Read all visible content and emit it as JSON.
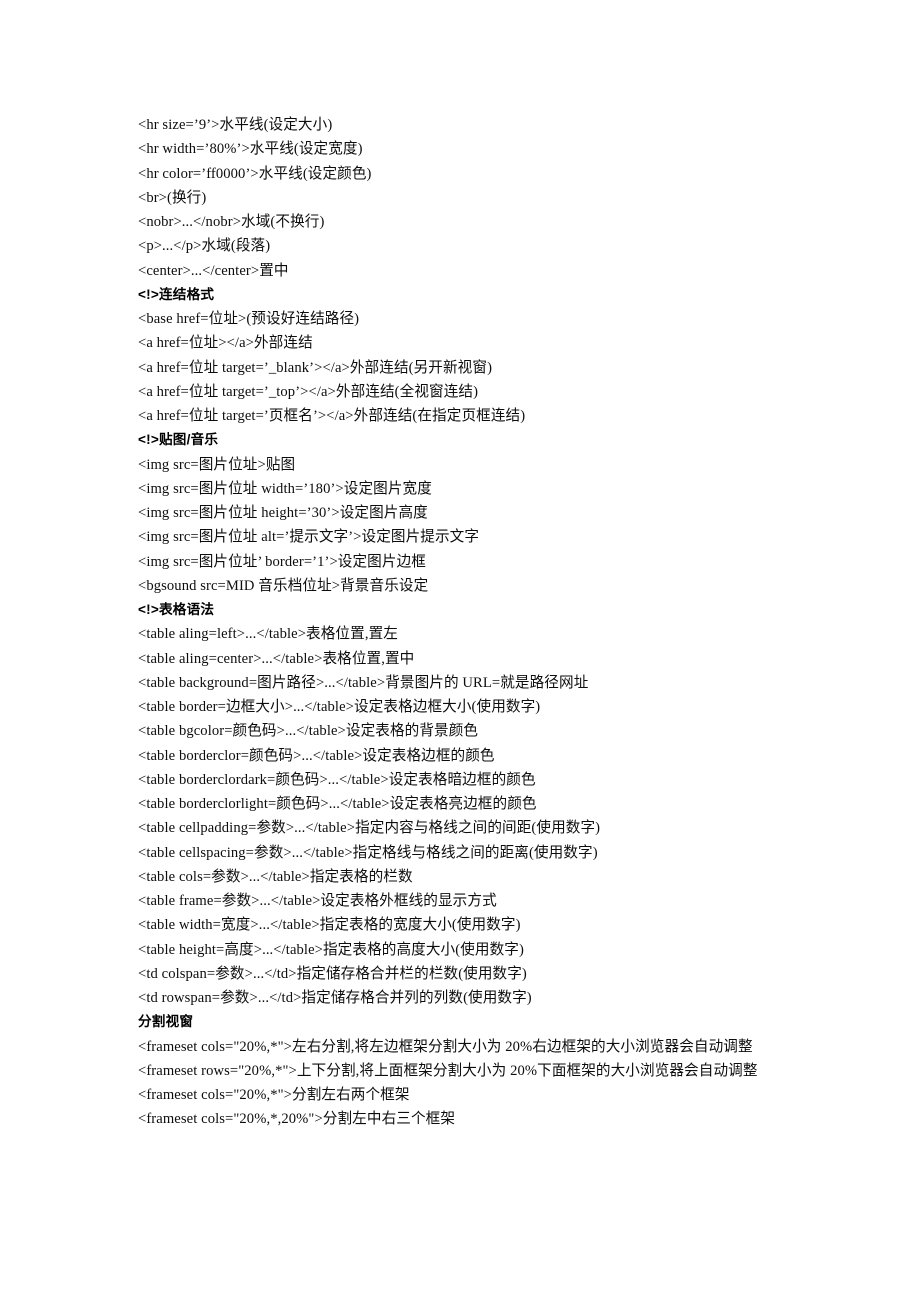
{
  "document": {
    "sections": [
      {
        "id": "horizontal-rule-and-text-block",
        "heading": null,
        "lines": [
          "<hr size=’9’>水平线(设定大小)",
          "<hr width=’80%’>水平线(设定宽度)",
          "<hr color=’ff0000’>水平线(设定颜色)",
          "<br>(换行)",
          "<nobr>...</nobr>水域(不换行)",
          "<p>...</p>水域(段落)",
          "<center>...</center>置中"
        ]
      },
      {
        "id": "link-format",
        "heading": "<!>连结格式",
        "lines": [
          "<base href=位址>(预设好连结路径)",
          "<a href=位址></a>外部连结",
          "<a href=位址 target=’_blank’></a>外部连结(另开新视窗)",
          "<a href=位址 target=’_top’></a>外部连结(全视窗连结)",
          "<a href=位址 target=’页框名’></a>外部连结(在指定页框连结)"
        ]
      },
      {
        "id": "image-and-music",
        "heading": "<!>贴图/音乐",
        "lines": [
          "<img src=图片位址>贴图",
          "<img src=图片位址 width=’180’>设定图片宽度",
          "<img src=图片位址 height=’30’>设定图片高度",
          "<img src=图片位址 alt=’提示文字’>设定图片提示文字",
          "<img src=图片位址’ border=’1’>设定图片边框",
          "<bgsound src=MID 音乐档位址>背景音乐设定"
        ]
      },
      {
        "id": "table-syntax",
        "heading": "<!>表格语法",
        "lines": [
          "<table aling=left>...</table>表格位置,置左",
          "<table aling=center>...</table>表格位置,置中",
          "<table background=图片路径>...</table>背景图片的 URL=就是路径网址",
          "<table border=边框大小>...</table>设定表格边框大小(使用数字)",
          "<table bgcolor=颜色码>...</table>设定表格的背景颜色",
          "<table borderclor=颜色码>...</table>设定表格边框的颜色",
          "<table borderclordark=颜色码>...</table>设定表格暗边框的颜色",
          "<table borderclorlight=颜色码>...</table>设定表格亮边框的颜色",
          "<table cellpadding=参数>...</table>指定内容与格线之间的间距(使用数字)",
          "<table cellspacing=参数>...</table>指定格线与格线之间的距离(使用数字)",
          "<table cols=参数>...</table>指定表格的栏数",
          "<table frame=参数>...</table>设定表格外框线的显示方式",
          "<table width=宽度>...</table>指定表格的宽度大小(使用数字)",
          "<table height=高度>...</table>指定表格的高度大小(使用数字)",
          "<td colspan=参数>...</td>指定储存格合并栏的栏数(使用数字)",
          "<td rowspan=参数>...</td>指定储存格合并列的列数(使用数字)"
        ]
      },
      {
        "id": "frameset",
        "heading": "分割视窗",
        "lines": [
          "<frameset cols=\"20%,*\">左右分割,将左边框架分割大小为 20%右边框架的大小浏览器会自动调整",
          "<frameset rows=\"20%,*\">上下分割,将上面框架分割大小为 20%下面框架的大小浏览器会自动调整",
          "<frameset cols=\"20%,*\">分割左右两个框架",
          "<frameset cols=\"20%,*,20%\">分割左中右三个框架"
        ]
      }
    ]
  }
}
